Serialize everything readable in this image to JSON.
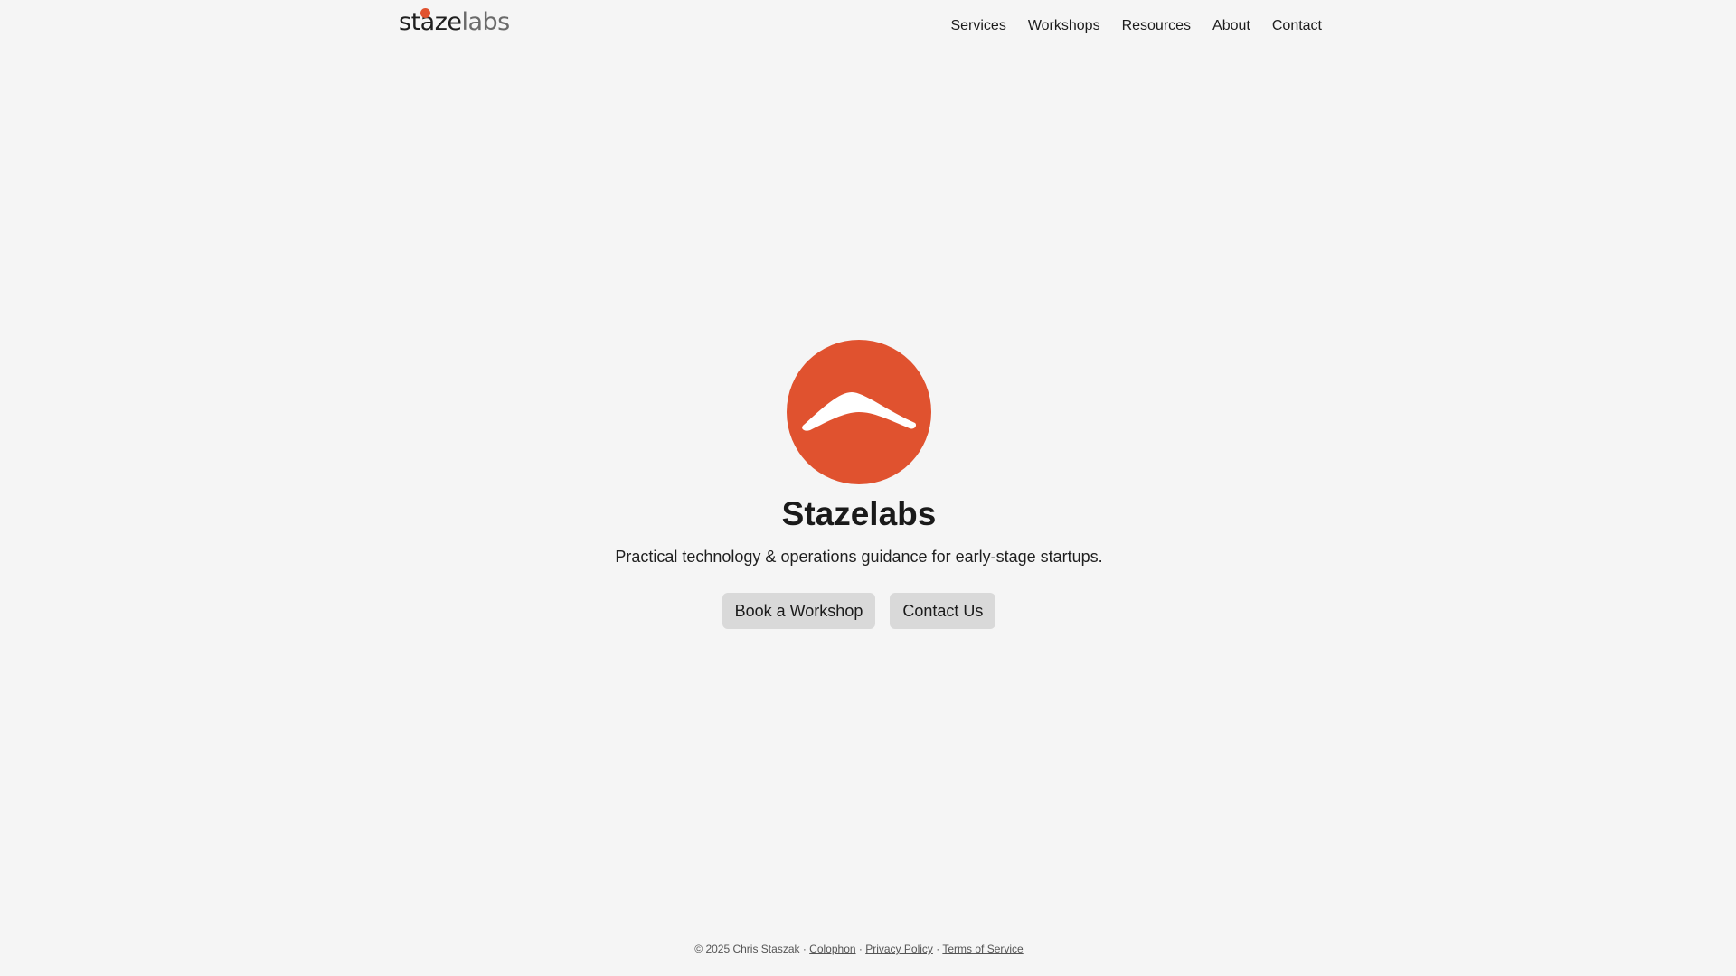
{
  "header": {
    "brand_dark": "staze",
    "brand_light": "labs",
    "nav": [
      {
        "label": "Services"
      },
      {
        "label": "Workshops"
      },
      {
        "label": "Resources"
      },
      {
        "label": "About"
      },
      {
        "label": "Contact"
      }
    ]
  },
  "hero": {
    "logo_icon": "boomerang-logo-icon",
    "title": "Stazelabs",
    "tagline": "Practical technology & operations guidance for early-stage startups.",
    "primary_cta": "Book a Workshop",
    "secondary_cta": "Contact Us"
  },
  "footer": {
    "copyright": "© 2025 Chris Staszak",
    "separator": " · ",
    "links": [
      {
        "label": "Colophon"
      },
      {
        "label": "Privacy Policy"
      },
      {
        "label": "Terms of Service"
      }
    ]
  },
  "colors": {
    "background": "#f5f5f5",
    "accent": "#e0522f",
    "button_bg": "#d9d9d9",
    "text": "#1c1c1c"
  }
}
